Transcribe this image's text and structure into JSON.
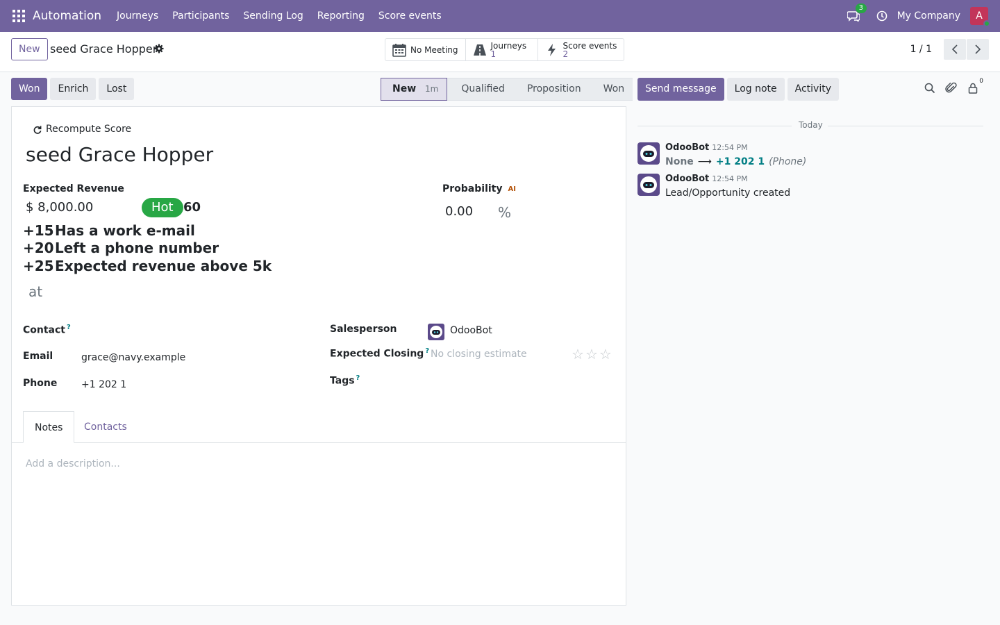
{
  "navbar": {
    "app_name": "Automation",
    "menu": [
      "Journeys",
      "Participants",
      "Sending Log",
      "Reporting",
      "Score events"
    ],
    "messages_badge": "3",
    "company": "My Company",
    "user_initial": "A"
  },
  "control_panel": {
    "new_label": "New",
    "record_title": "seed Grace Hopper",
    "smart_buttons": {
      "meeting": "No Meeting",
      "journeys_label": "Journeys",
      "journeys_count": "1",
      "score_label": "Score events",
      "score_count": "2"
    },
    "pager": "1 / 1"
  },
  "status_bar": {
    "won": "Won",
    "enrich": "Enrich",
    "lost": "Lost",
    "stages": [
      "New",
      "Qualified",
      "Proposition",
      "Won"
    ],
    "active_stage_duration": "1m"
  },
  "form": {
    "recompute_label": "Recompute Score",
    "lead_name": "seed Grace Hopper",
    "expected_revenue_label": "Expected Revenue",
    "expected_revenue": "$ 8,000.00",
    "score_badge": "Hot",
    "score_value": "60",
    "score_rules": [
      {
        "points": "+15",
        "label": "Has a work e-mail"
      },
      {
        "points": "+20",
        "label": "Left a phone number"
      },
      {
        "points": "+25",
        "label": "Expected revenue above 5k"
      }
    ],
    "at_text": "at",
    "probability_label": "Probability",
    "ai_label": "AI",
    "probability_value": "0.00",
    "probability_unit": "%",
    "contact_label": "Contact",
    "email_label": "Email",
    "email_value": "grace@navy.example",
    "phone_label": "Phone",
    "phone_value": "+1 202 1",
    "salesperson_label": "Salesperson",
    "salesperson_value": "OdooBot",
    "expected_closing_label": "Expected Closing",
    "expected_closing_placeholder": "No closing estimate",
    "tags_label": "Tags",
    "help_mark": "?",
    "priority_stars": 0,
    "tabs": [
      "Notes",
      "Contacts"
    ],
    "description_placeholder": "Add a description..."
  },
  "chatter": {
    "send_message": "Send message",
    "log_note": "Log note",
    "activity": "Activity",
    "followers_count": "0",
    "date_separator": "Today",
    "messages": [
      {
        "author": "OdooBot",
        "time": "12:54 PM",
        "old_value": "None",
        "new_value": "+1 202 1",
        "field": "(Phone)"
      },
      {
        "author": "OdooBot",
        "time": "12:54 PM",
        "body": "Lead/Opportunity created"
      }
    ]
  },
  "colors": {
    "brand": "#71639e",
    "hot": "#28a745",
    "link": "#017e84"
  }
}
